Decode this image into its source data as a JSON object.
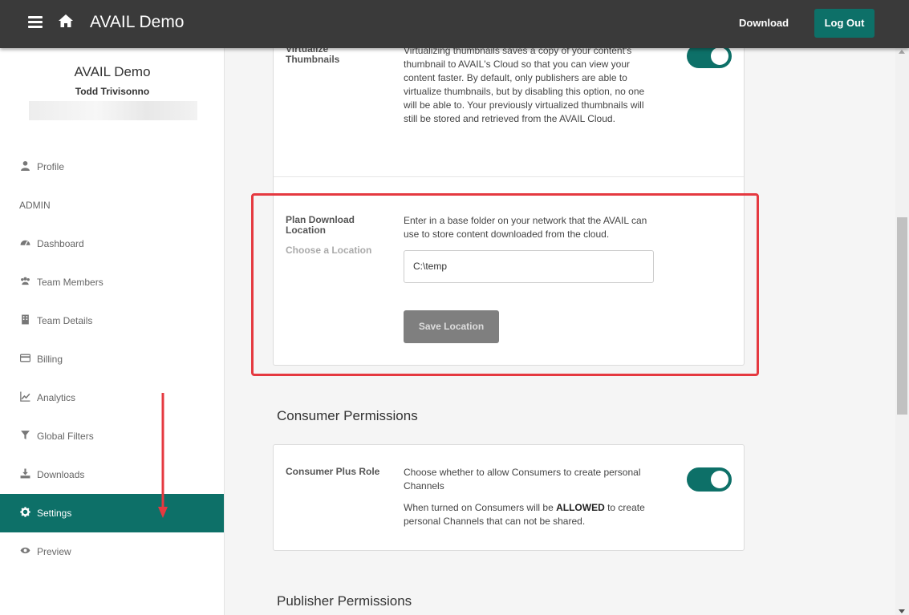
{
  "topbar": {
    "title": "AVAIL Demo",
    "download_label": "Download",
    "logout_label": "Log Out",
    "menu_icon": "hamburger-icon",
    "home_icon": "home-icon"
  },
  "sidebar": {
    "org_name": "AVAIL Demo",
    "user_name": "Todd Trivisonno",
    "profile": "Profile",
    "admin_heading": "ADMIN",
    "items": [
      {
        "label": "Dashboard",
        "icon": "dashboard-icon"
      },
      {
        "label": "Team Members",
        "icon": "users-icon"
      },
      {
        "label": "Team Details",
        "icon": "building-icon"
      },
      {
        "label": "Billing",
        "icon": "credit-card-icon"
      },
      {
        "label": "Analytics",
        "icon": "line-chart-icon"
      },
      {
        "label": "Global Filters",
        "icon": "filter-icon"
      },
      {
        "label": "Downloads",
        "icon": "download-icon"
      },
      {
        "label": "Settings",
        "icon": "gear-icon",
        "active": true
      },
      {
        "label": "Preview",
        "icon": "eye-icon"
      }
    ]
  },
  "settings": {
    "virtualize": {
      "label": "Virtualize Thumbnails",
      "description": "Virtualizing thumbnails saves a copy of your content's thumbnail to AVAIL's Cloud so that you can view your content faster. By default, only publishers are able to virtualize thumbnails, but by disabling this option, no one will be able to. Your previously virtualized thumbnails will still be stored and retrieved from the AVAIL Cloud.",
      "enabled": true
    },
    "plan_download": {
      "label": "Plan Download Location",
      "sub_label": "Choose a Location",
      "description": "Enter in a base folder on your network that the AVAIL can use to store content downloaded from the cloud.",
      "value": "C:\\temp",
      "save_label": "Save Location"
    },
    "consumer_heading": "Consumer Permissions",
    "consumer_plus": {
      "label": "Consumer Plus Role",
      "description": "Choose whether to allow Consumers to create personal Channels",
      "note_prefix": "When turned on Consumers will be ",
      "note_bold": "ALLOWED",
      "note_suffix": " to create personal Channels that can not be shared.",
      "enabled": true
    },
    "publisher_heading": "Publisher Permissions"
  },
  "colors": {
    "accent": "#0d7068",
    "topbar": "#3a3a3a",
    "highlight": "#e53940"
  }
}
